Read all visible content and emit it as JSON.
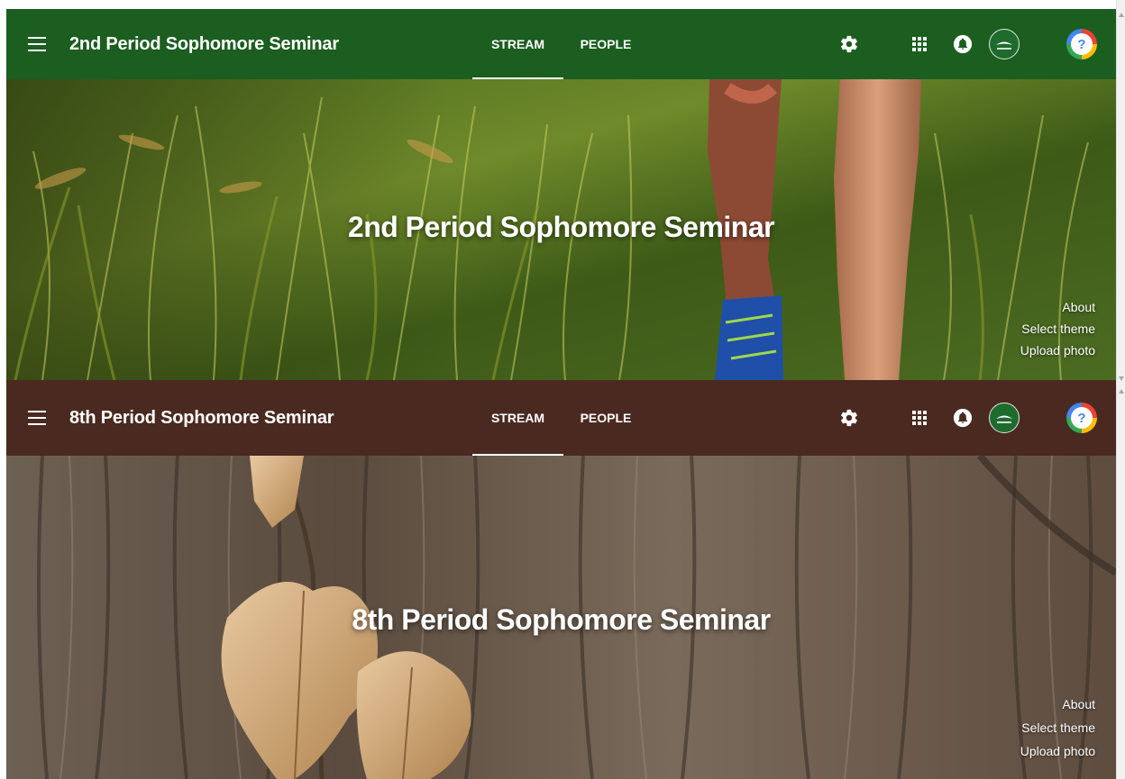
{
  "classes": [
    {
      "title": "2nd Period Sophomore Seminar",
      "theme_color": "#1b5e20",
      "tabs": {
        "stream": "STREAM",
        "people": "PEOPLE"
      },
      "active_tab": "STREAM",
      "banner": {
        "title": "2nd Period Sophomore Seminar",
        "image": "grass-runner-photo",
        "links": {
          "about": "About",
          "select_theme": "Select theme",
          "upload_photo": "Upload photo"
        }
      },
      "icons": {
        "menu": "menu-icon",
        "settings": "gear-icon",
        "apps": "apps-grid-icon",
        "notifications": "bell-icon",
        "school": "school-logo",
        "help": "help-icon"
      },
      "help_glyph": "?"
    },
    {
      "title": "8th Period Sophomore Seminar",
      "theme_color": "#4a2a20",
      "tabs": {
        "stream": "STREAM",
        "people": "PEOPLE"
      },
      "active_tab": "STREAM",
      "banner": {
        "title": "8th Period Sophomore Seminar",
        "image": "tree-bark-leaves-photo",
        "links": {
          "about": "About",
          "select_theme": "Select theme",
          "upload_photo": "Upload photo"
        }
      },
      "icons": {
        "menu": "menu-icon",
        "settings": "gear-icon",
        "apps": "apps-grid-icon",
        "notifications": "bell-icon",
        "school": "school-logo",
        "help": "help-icon"
      },
      "help_glyph": "?"
    }
  ]
}
